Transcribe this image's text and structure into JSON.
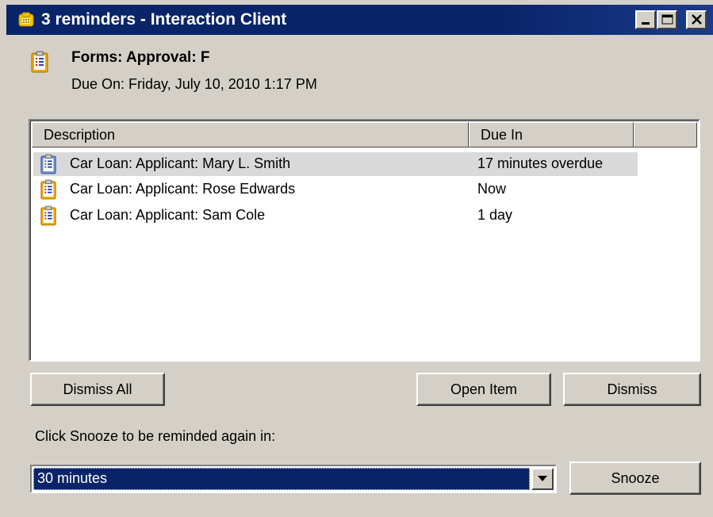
{
  "window": {
    "title": "3 reminders - Interaction Client",
    "minimize_icon": "minimize-icon",
    "maximize_icon": "maximize-icon",
    "close_icon": "close-icon"
  },
  "reminder": {
    "title": "Forms: Approval: F",
    "due_on": "Due On: Friday, July 10, 2010 1:17 PM",
    "icon": "form-icon"
  },
  "list": {
    "columns": [
      "Description",
      "Due In"
    ],
    "rows": [
      {
        "description": "Car Loan: Applicant: Mary L. Smith",
        "due_in": "17 minutes overdue",
        "selected": true
      },
      {
        "description": "Car Loan: Applicant: Rose Edwards",
        "due_in": "Now",
        "selected": false
      },
      {
        "description": "Car Loan: Applicant: Sam Cole",
        "due_in": "1 day",
        "selected": false
      }
    ]
  },
  "buttons": {
    "dismiss_all": "Dismiss All",
    "open_item": "Open Item",
    "dismiss": "Dismiss",
    "snooze": "Snooze"
  },
  "snooze": {
    "label": "Click Snooze to be reminded again in:",
    "selected_option": "30 minutes"
  },
  "colors": {
    "titlebar": "#0a246a",
    "selection": "#0a246a",
    "face": "#d4d0c8"
  }
}
